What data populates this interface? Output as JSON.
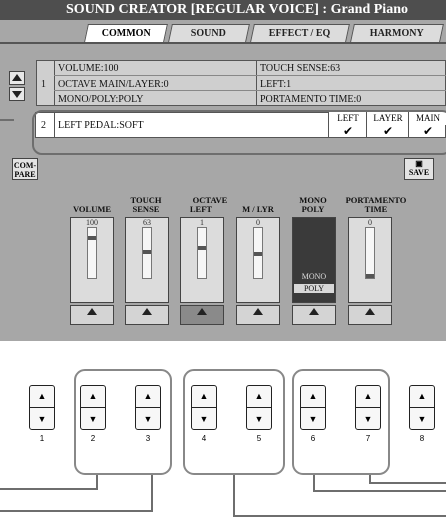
{
  "title": "SOUND CREATOR [REGULAR VOICE] : Grand Piano",
  "tabs": [
    "COMMON",
    "SOUND",
    "EFFECT / EQ",
    "HARMONY"
  ],
  "rows": [
    {
      "num": "",
      "left": "VOLUME:100",
      "right": "TOUCH SENSE:63"
    },
    {
      "num": "1",
      "left": "OCTAVE MAIN/LAYER:0",
      "right": "LEFT:1"
    },
    {
      "num": "",
      "left": "MONO/POLY:POLY",
      "right": "PORTAMENTO TIME:0"
    }
  ],
  "pedal": {
    "num": "2",
    "label": "LEFT PEDAL:SOFT",
    "cols": [
      "LEFT",
      "LAYER",
      "MAIN"
    ],
    "checks": [
      "✔",
      "✔",
      "✔"
    ]
  },
  "compare_label": "COM-\nPARE",
  "save_label": "SAVE",
  "sliders": {
    "labels": [
      [
        "",
        "VOLUME"
      ],
      [
        "TOUCH",
        "SENSE"
      ],
      [
        "",
        "LEFT"
      ],
      [
        "",
        "M / LYR"
      ],
      [
        "MONO",
        "POLY"
      ],
      [
        "PORTAMENTO",
        "TIME"
      ]
    ],
    "octave_header": "OCTAVE",
    "values": [
      "100",
      "63",
      "1",
      "0",
      "",
      "0"
    ],
    "mono_options": [
      "MONO",
      "POLY"
    ]
  },
  "physical_buttons": [
    "1",
    "2",
    "3",
    "4",
    "5",
    "6",
    "7",
    "8"
  ],
  "up_glyph": "▲",
  "down_glyph": "▼"
}
